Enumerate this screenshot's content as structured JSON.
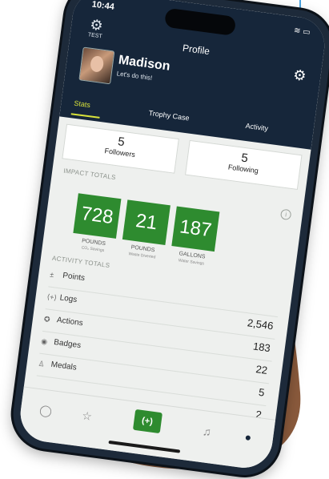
{
  "status": {
    "time": "10:44"
  },
  "header": {
    "title": "Profile",
    "test_label": "TEST"
  },
  "profile": {
    "name": "Madison",
    "tagline": "Let's do this!"
  },
  "tabs": [
    {
      "label": "Stats",
      "active": true
    },
    {
      "label": "Trophy Case",
      "active": false
    },
    {
      "label": "Activity",
      "active": false
    }
  ],
  "follow": {
    "followers": {
      "count": "5",
      "label": "Followers"
    },
    "following": {
      "count": "5",
      "label": "Following"
    }
  },
  "impact": {
    "heading": "IMPACT TOTALS",
    "items": [
      {
        "value": "728",
        "unit": "POUNDS",
        "sub": "CO₂ Savings"
      },
      {
        "value": "21",
        "unit": "POUNDS",
        "sub": "Waste Diverted"
      },
      {
        "value": "187",
        "unit": "GALLONS",
        "sub": "Water Savings"
      }
    ]
  },
  "activity": {
    "heading": "ACTIVITY TOTALS",
    "rows": [
      {
        "label": "Points",
        "icon": "plus-minus-icon",
        "value": ""
      },
      {
        "label": "Logs",
        "icon": "log-icon",
        "value": "2,546"
      },
      {
        "label": "Actions",
        "icon": "action-icon",
        "value": "183"
      },
      {
        "label": "Badges",
        "icon": "badge-icon",
        "value": "22"
      },
      {
        "label": "Medals",
        "icon": "medal-icon",
        "value": "5"
      },
      {
        "label": "",
        "icon": "",
        "value": "2"
      }
    ]
  },
  "nav": {
    "center_label": "(+)"
  },
  "colors": {
    "header": "#16263a",
    "accent": "#d9e33b",
    "green": "#2e8b2f"
  }
}
